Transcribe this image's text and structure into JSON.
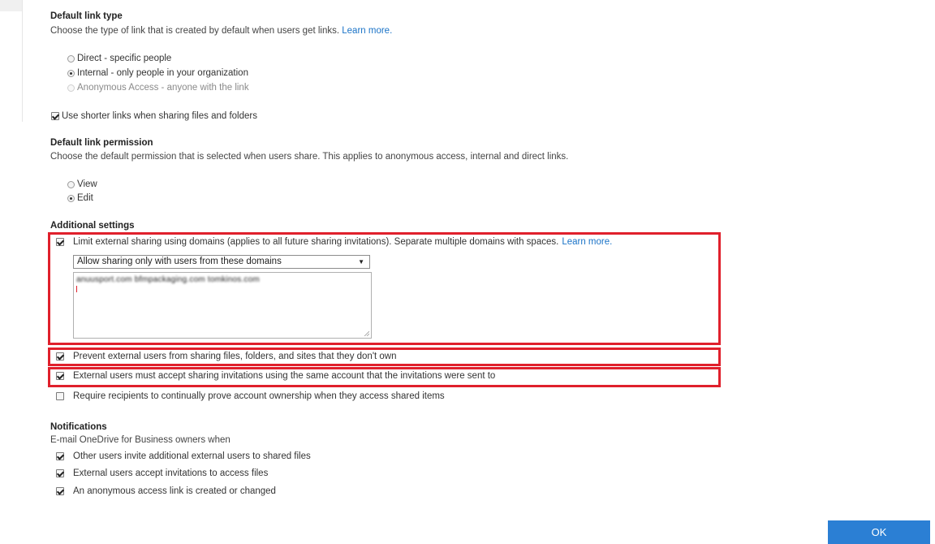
{
  "link_type": {
    "heading": "Default link type",
    "description": "Choose the type of link that is created by default when users get links.",
    "learn_more": "Learn more.",
    "options": [
      {
        "label": "Direct - specific people",
        "checked": false,
        "disabled": false
      },
      {
        "label": "Internal - only people in your organization",
        "checked": true,
        "disabled": false
      },
      {
        "label": "Anonymous Access - anyone with the link",
        "checked": false,
        "disabled": true
      }
    ],
    "shorter_links": {
      "label": "Use shorter links when sharing files and folders",
      "checked": true
    }
  },
  "link_permission": {
    "heading": "Default link permission",
    "description": "Choose the default permission that is selected when users share. This applies to anonymous access, internal and direct links.",
    "options": [
      {
        "label": "View",
        "checked": false
      },
      {
        "label": "Edit",
        "checked": true
      }
    ]
  },
  "additional": {
    "heading": "Additional settings",
    "limit_domains": {
      "label": "Limit external sharing using domains (applies to all future sharing invitations). Separate multiple domains with spaces.",
      "learn_more": "Learn more.",
      "checked": true
    },
    "domain_mode_select": {
      "value": "Allow sharing only with users from these domains",
      "arrow": "▼"
    },
    "domains_text": "anuusport.com bfmpackaging.com tomkinos.com",
    "prevent_resharing": {
      "label": "Prevent external users from sharing files, folders, and sites that they don't own",
      "checked": true
    },
    "same_account": {
      "label": "External users must accept sharing invitations using the same account that the invitations were sent to",
      "checked": true
    },
    "prove_ownership": {
      "label": "Require recipients to continually prove account ownership when they access shared items",
      "checked": false
    }
  },
  "notifications": {
    "heading": "Notifications",
    "description": "E-mail OneDrive for Business owners when",
    "items": [
      {
        "label": "Other users invite additional external users to shared files",
        "checked": true
      },
      {
        "label": "External users accept invitations to access files",
        "checked": true
      },
      {
        "label": "An anonymous access link is created or changed",
        "checked": true
      }
    ]
  },
  "ok_button": "OK",
  "colors": {
    "highlight": "#e0202c",
    "primary": "#2b7fd4",
    "link": "#1a73c7"
  }
}
